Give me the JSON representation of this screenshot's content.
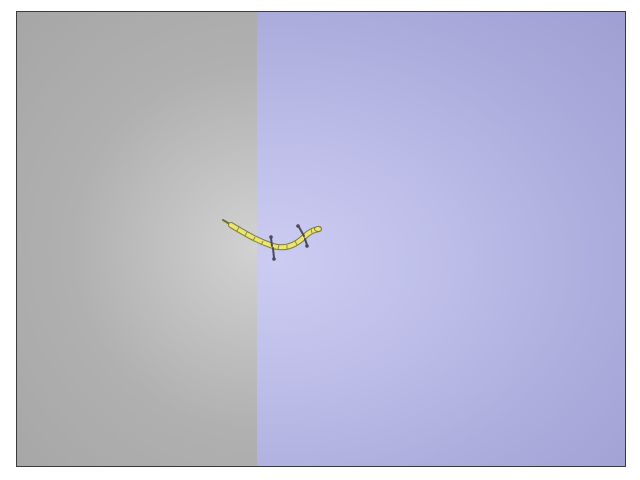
{
  "scene": {
    "left_panel": {
      "color": "#b5b5b5"
    },
    "right_panel": {
      "color": "#b7b8e6"
    },
    "creature": {
      "body_color": "#e9e46a",
      "body_outline_color": "#7a7a3a",
      "leg_color": "#4a4a58",
      "segment_count": 11,
      "leg_pairs": 2
    }
  }
}
